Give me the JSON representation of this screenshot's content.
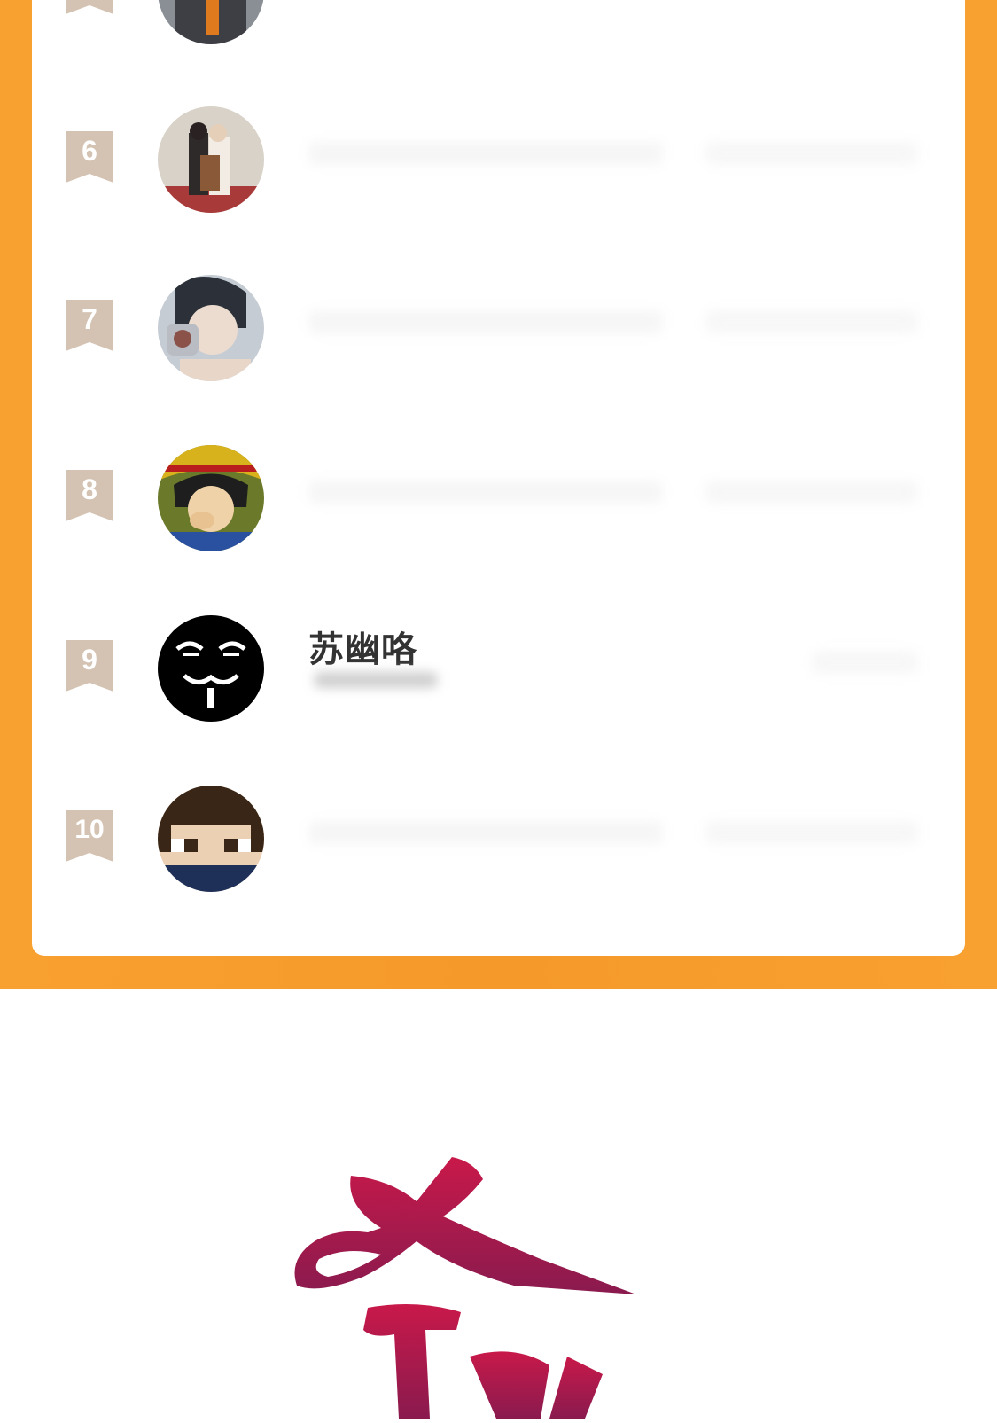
{
  "colors": {
    "band": "#f59a2a",
    "card": "#ffffff",
    "rank_tag": "#d4c3b2",
    "name_text": "#333333",
    "score_text": "#f3a21e",
    "logo_top": "#c8194a",
    "logo_bottom": "#8a1a4e"
  },
  "leaderboard": {
    "rows": [
      {
        "rank": "6",
        "name": ""
      },
      {
        "rank": "7",
        "name": ""
      },
      {
        "rank": "8",
        "name": ""
      },
      {
        "rank": "9",
        "name": "苏幽咯"
      },
      {
        "rank": "10",
        "name": ""
      }
    ]
  },
  "icons": {
    "rank_badge": "bookmark-ribbon-icon",
    "logo": "calligraphy-logo"
  }
}
